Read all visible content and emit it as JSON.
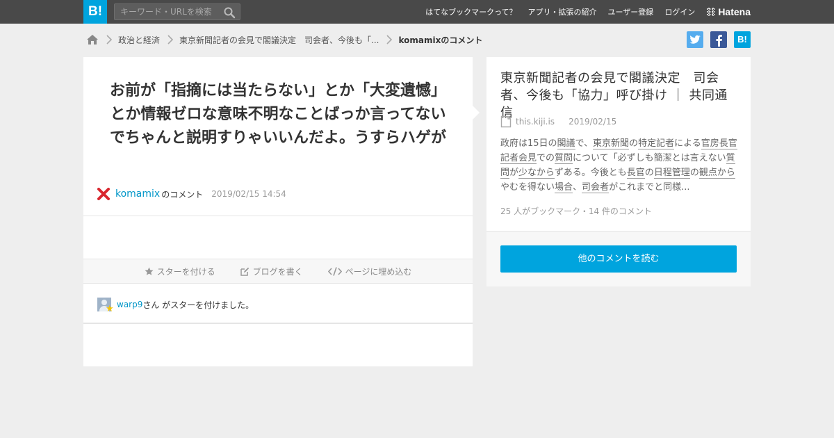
{
  "header": {
    "logo": "B!",
    "search_placeholder": "キーワード・URLを検索",
    "nav": [
      "はてなブックマークって？",
      "アプリ・拡張の紹介",
      "ユーザー登録",
      "ログイン"
    ],
    "hatena": "Hatena"
  },
  "breadcrumb": {
    "items": [
      "政治と経済",
      "東京新聞記者の会見で閣議決定　司会者、今後も「..."
    ],
    "current": "komamixのコメント"
  },
  "share": {
    "hatena_label": "B!"
  },
  "comment": {
    "text": "お前が「指摘には当たらない」とか「大変遺憾」とか情報ゼロな意味不明なことばっか言ってないでちゃんと説明すりゃいいんだよ。うすらハゲが",
    "user": "komamix",
    "user_suffix": "のコメント",
    "date": "2019/02/15 14:54"
  },
  "actions": [
    "スターを付ける",
    "ブログを書く",
    "ページに埋め込む"
  ],
  "stars": {
    "user": "warp9",
    "text": "さん がスターを付けました。"
  },
  "entry": {
    "title": "東京新聞記者の会見で閣議決定　司会者、今後も「協力」呼び掛け ｜ 共同通信",
    "domain": "this.kiji.is",
    "date": "2019/02/15",
    "excerpt": [
      {
        "t": "政府は15日の",
        "k": false
      },
      {
        "t": "閣議",
        "k": true
      },
      {
        "t": "で、",
        "k": false
      },
      {
        "t": "東京新聞",
        "k": true
      },
      {
        "t": "の",
        "k": false
      },
      {
        "t": "特定記者",
        "k": true
      },
      {
        "t": "による",
        "k": false
      },
      {
        "t": "官房長官記者会見",
        "k": true
      },
      {
        "t": "での",
        "k": false
      },
      {
        "t": "質問",
        "k": true
      },
      {
        "t": "について「必ずしも簡潔とは言えない",
        "k": false
      },
      {
        "t": "質問",
        "k": true
      },
      {
        "t": "が",
        "k": false
      },
      {
        "t": "少なから",
        "k": true
      },
      {
        "t": "ずある。今後とも",
        "k": false
      },
      {
        "t": "長官",
        "k": true
      },
      {
        "t": "の",
        "k": false
      },
      {
        "t": "日程管理",
        "k": true
      },
      {
        "t": "の",
        "k": false
      },
      {
        "t": "観点から",
        "k": true
      },
      {
        "t": "やむを得ない",
        "k": false
      },
      {
        "t": "場合",
        "k": true
      },
      {
        "t": "、",
        "k": false
      },
      {
        "t": "司会者",
        "k": true
      },
      {
        "t": "がこれまでと同様...",
        "k": false
      }
    ],
    "counts": "25 人がブックマーク・14 件のコメント",
    "read_button": "他のコメントを読む"
  }
}
